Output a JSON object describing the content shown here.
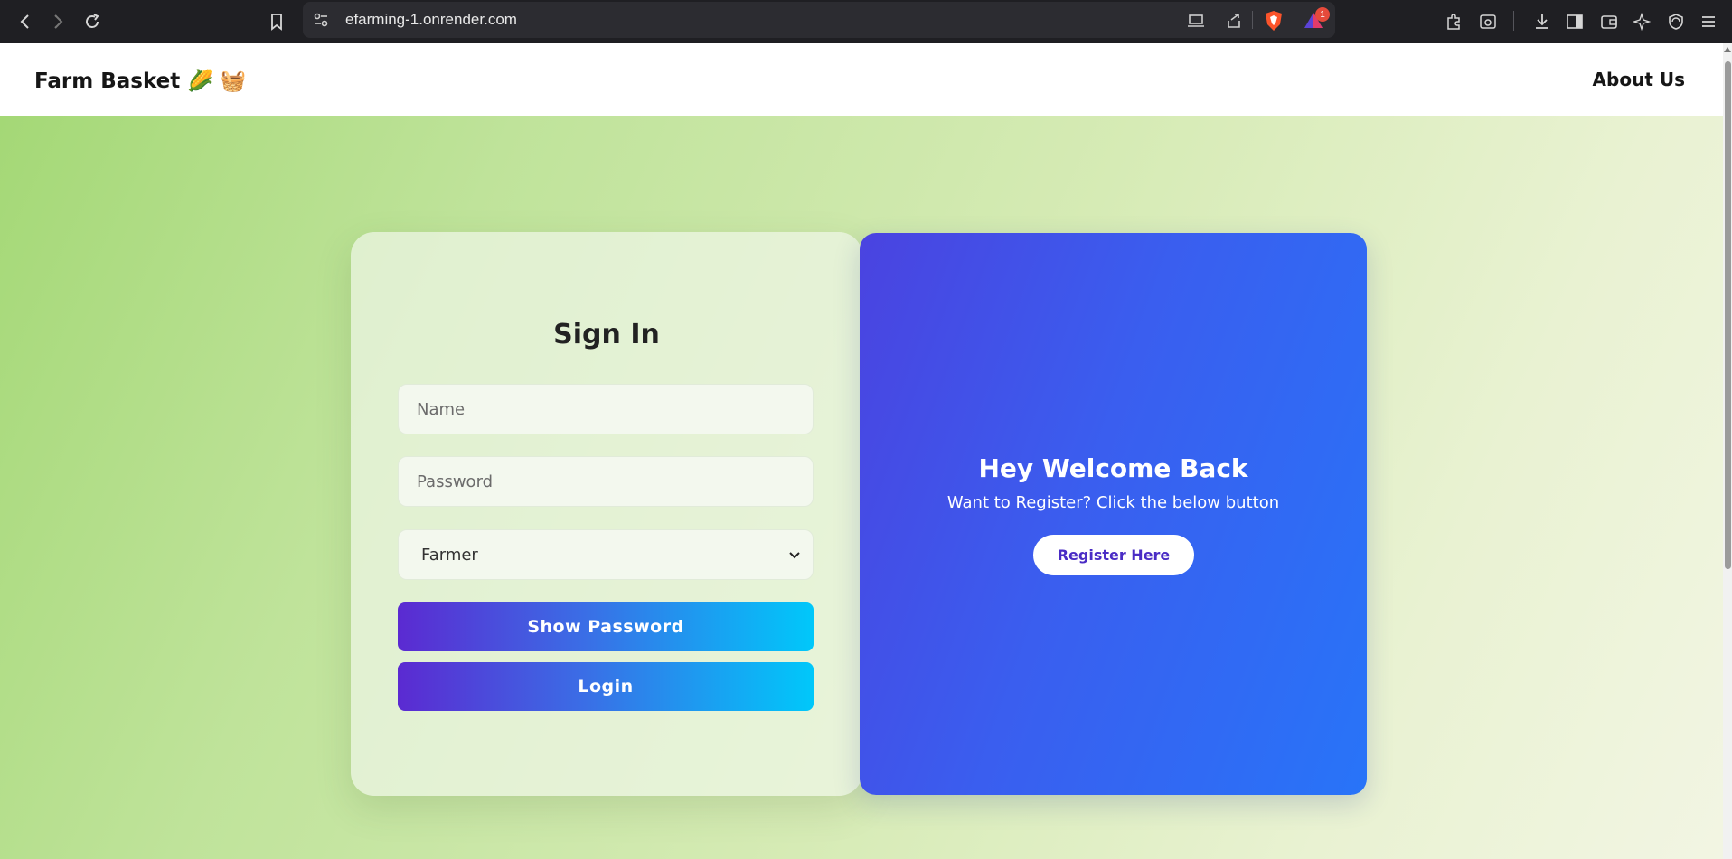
{
  "browser": {
    "url": "efarming-1.onrender.com",
    "rewards_badge": "1"
  },
  "header": {
    "brand": "Farm Basket",
    "brand_emojis": "🌽 🧺",
    "nav_about": "About Us"
  },
  "signin": {
    "title": "Sign In",
    "name_placeholder": "Name",
    "password_placeholder": "Password",
    "role_selected": "Farmer",
    "show_password_label": "Show Password",
    "login_label": "Login"
  },
  "welcome": {
    "title": "Hey Welcome Back",
    "subtitle": "Want to Register? Click the below button",
    "register_label": "Register Here"
  },
  "colors": {
    "panel_gradient_start": "#4a43e0",
    "panel_gradient_end": "#2874f8",
    "button_gradient_start": "#5b2ad1",
    "button_gradient_end": "#00c8fa"
  }
}
